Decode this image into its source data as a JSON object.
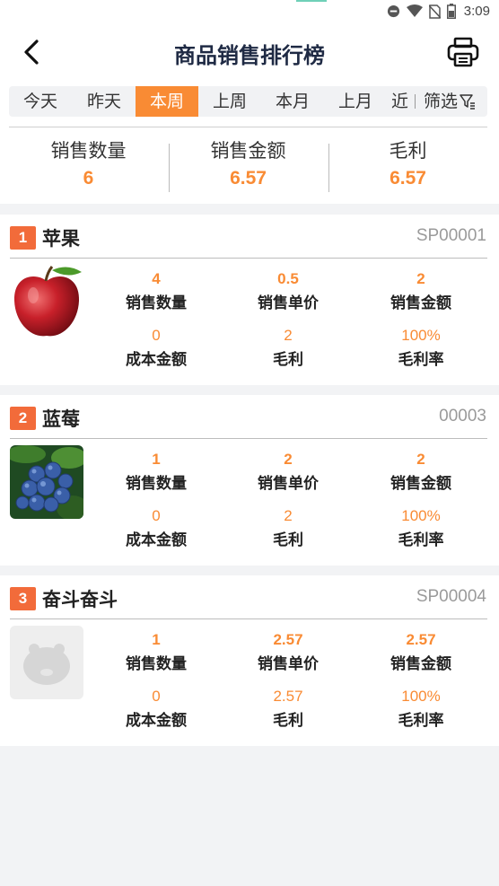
{
  "statusbar": {
    "time": "3:09"
  },
  "header": {
    "title": "商品销售排行榜"
  },
  "tabs": [
    {
      "label": "今天"
    },
    {
      "label": "昨天"
    },
    {
      "label": "本周"
    },
    {
      "label": "上周"
    },
    {
      "label": "本月"
    },
    {
      "label": "上月"
    },
    {
      "label": "近"
    }
  ],
  "active_tab": "本周",
  "filter": {
    "label": "筛选"
  },
  "summary": {
    "qty_label": "销售数量",
    "qty_value": "6",
    "amount_label": "销售金额",
    "amount_value": "6.57",
    "profit_label": "毛利",
    "profit_value": "6.57"
  },
  "labels": {
    "qty": "销售数量",
    "unit_price": "销售单价",
    "amount": "销售金额",
    "cost": "成本金额",
    "profit": "毛利",
    "margin": "毛利率"
  },
  "products": [
    {
      "rank": "1",
      "name": "苹果",
      "code": "SP00001",
      "image": "apple-image",
      "qty": "4",
      "unit_price": "0.5",
      "amount": "2",
      "cost": "0",
      "profit": "2",
      "margin": "100%"
    },
    {
      "rank": "2",
      "name": "蓝莓",
      "code": "00003",
      "image": "blueberry-image",
      "qty": "1",
      "unit_price": "2",
      "amount": "2",
      "cost": "0",
      "profit": "2",
      "margin": "100%"
    },
    {
      "rank": "3",
      "name": "奋斗奋斗",
      "code": "SP00004",
      "image": "placeholder-image",
      "qty": "1",
      "unit_price": "2.57",
      "amount": "2.57",
      "cost": "0",
      "profit": "2.57",
      "margin": "100%"
    }
  ],
  "colors": {
    "accent": "#f98b34",
    "rank_badge": "#f26b3a",
    "title": "#1f2a44"
  }
}
